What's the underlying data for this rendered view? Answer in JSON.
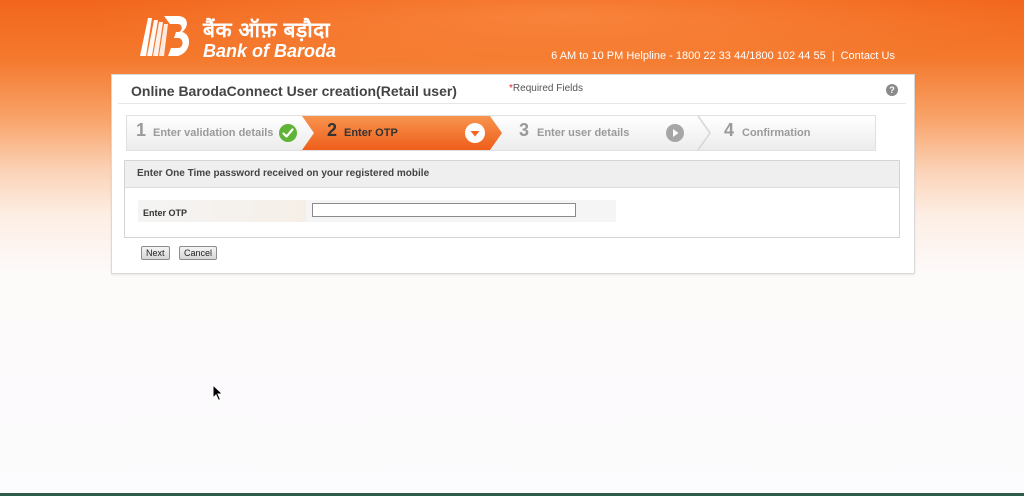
{
  "header": {
    "brand_hindi": "बैंक ऑफ़ बड़ौदा",
    "brand_english": "Bank of Baroda",
    "helpline": "6 AM to 10 PM Helpline - 1800 22 33 44/1800 102 44 55",
    "separator": "|",
    "contact_link": "Contact Us"
  },
  "panel": {
    "title": "Online BarodaConnect User creation(Retail user)",
    "required_asterisk": "*",
    "required_text": "Required Fields",
    "help_icon": "?"
  },
  "steps": [
    {
      "number": "1",
      "label": "Enter validation details",
      "state": "completed",
      "icon": "check-circle-icon"
    },
    {
      "number": "2",
      "label": "Enter OTP",
      "state": "active",
      "icon": "chevron-down-circle-icon"
    },
    {
      "number": "3",
      "label": "Enter user details",
      "state": "pending",
      "icon": "chevron-right-circle-icon"
    },
    {
      "number": "4",
      "label": "Confirmation",
      "state": "pending"
    }
  ],
  "otp_section": {
    "heading": "Enter One Time password received on your registered mobile",
    "field_label": "Enter OTP",
    "field_value": ""
  },
  "buttons": {
    "next": "Next",
    "cancel": "Cancel"
  },
  "colors": {
    "brand_orange": "#f2661c",
    "step_active": "#f26722",
    "step_completed": "#5fb336"
  }
}
